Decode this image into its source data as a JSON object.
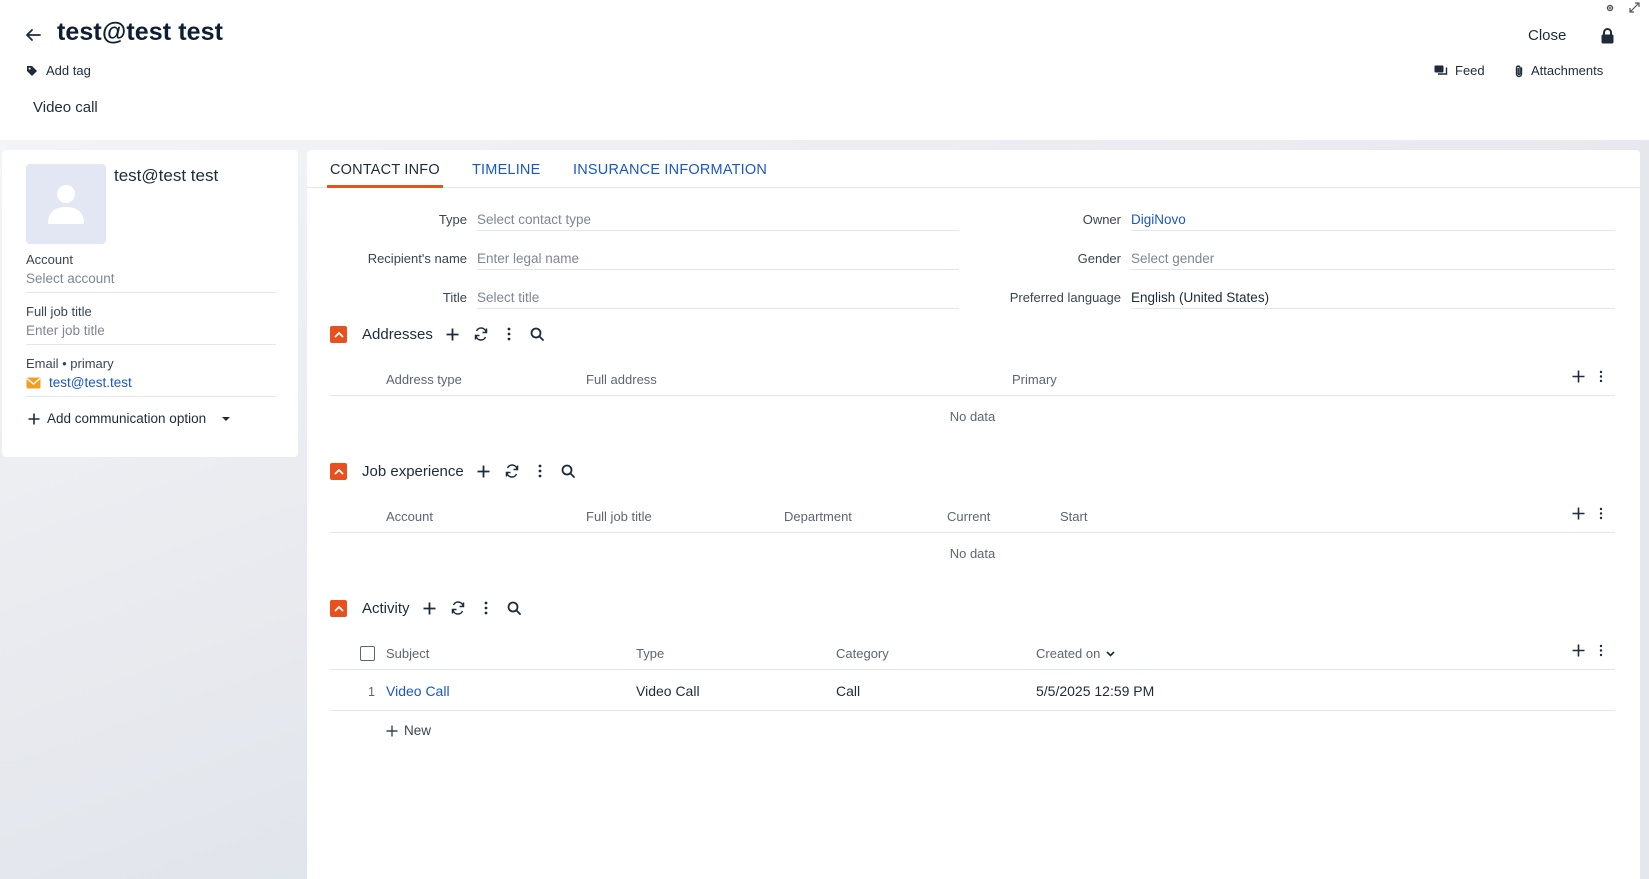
{
  "header": {
    "title": "test@test test",
    "add_tag": "Add tag",
    "subtitle": "Video call",
    "close": "Close",
    "feed": "Feed",
    "attachments": "Attachments"
  },
  "profile": {
    "name": "test@test test",
    "account_label": "Account",
    "account_placeholder": "Select account",
    "job_label": "Full job title",
    "job_placeholder": "Enter job title",
    "email_label": "Email • primary",
    "email_value": "test@test.test",
    "add_comm": "Add communication option"
  },
  "tabs": [
    {
      "label": "CONTACT INFO",
      "active": true
    },
    {
      "label": "TIMELINE",
      "active": false
    },
    {
      "label": "INSURANCE INFORMATION",
      "active": false
    }
  ],
  "fields": {
    "type_label": "Type",
    "type_placeholder": "Select contact type",
    "recipient_label": "Recipient's name",
    "recipient_placeholder": "Enter legal name",
    "title_label": "Title",
    "title_placeholder": "Select title",
    "owner_label": "Owner",
    "owner_value": "DigiNovo",
    "gender_label": "Gender",
    "gender_placeholder": "Select gender",
    "language_label": "Preferred language",
    "language_value": "English (United States)"
  },
  "addresses": {
    "title": "Addresses",
    "columns": [
      "Address type",
      "Full address",
      "Primary"
    ],
    "empty": "No data"
  },
  "job_experience": {
    "title": "Job experience",
    "columns": [
      "Account",
      "Full job title",
      "Department",
      "Current",
      "Start"
    ],
    "empty": "No data"
  },
  "activity": {
    "title": "Activity",
    "columns": [
      "Subject",
      "Type",
      "Category",
      "Created on"
    ],
    "rows": [
      {
        "num": "1",
        "subject": "Video Call",
        "type": "Video Call",
        "category": "Call",
        "created": "5/5/2025 12:59 PM"
      }
    ],
    "new_label": "New"
  },
  "colors": {
    "accent": "#e8501e",
    "link": "#1a56c8",
    "text": "#1d2b3a"
  }
}
